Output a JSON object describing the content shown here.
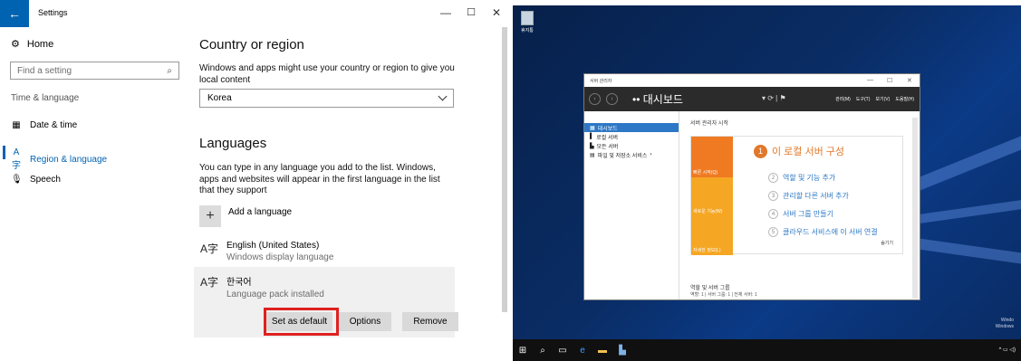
{
  "settings": {
    "window_title": "Settings",
    "back_icon": "back-arrow-icon",
    "controls": {
      "minimize": "—",
      "maximize": "☐",
      "close": "✕"
    },
    "nav": {
      "home": "Home",
      "search_placeholder": "Find a setting",
      "section": "Time & language",
      "items": [
        {
          "label": "Date & time",
          "icon": "calendar-clock-icon",
          "active": false
        },
        {
          "label": "Region & language",
          "icon": "region-language-icon",
          "active": true
        },
        {
          "label": "Speech",
          "icon": "microphone-icon",
          "active": false
        }
      ]
    },
    "country": {
      "heading": "Country or region",
      "description": "Windows and apps might use your country or region to give you local content",
      "selected": "Korea"
    },
    "languages": {
      "heading": "Languages",
      "description": "You can type in any language you add to the list. Windows, apps and websites will appear in the first language in the list that they support",
      "add_label": "Add a language",
      "list": [
        {
          "name": "English (United States)",
          "status": "Windows display language"
        },
        {
          "name": "한국어",
          "status": "Language pack installed"
        }
      ],
      "buttons": {
        "set_default": "Set as default",
        "options": "Options",
        "remove": "Remove"
      }
    }
  },
  "server": {
    "desktop_icon_label": "휴지통",
    "window_title": "서버 관리자",
    "breadcrumb": "•• 대시보드",
    "menu": [
      "관리(M)",
      "도구(T)",
      "보기(V)",
      "도움말(H)"
    ],
    "left_nav": [
      "대시보드",
      "로컬 서버",
      "모든 서버",
      "파일 및 저장소 서비스"
    ],
    "start_label": "서버 관리자 시작",
    "tiles": [
      "빠른 시작(Q)",
      "새로운 기능(W)",
      "자세한 정보(L)"
    ],
    "step1": {
      "num": "1",
      "label": "이 로컬 서버 구성"
    },
    "steps": [
      {
        "num": "2",
        "label": "역할 및 기능 추가"
      },
      {
        "num": "3",
        "label": "관리할 다른 서버 추가"
      },
      {
        "num": "4",
        "label": "서버 그룹 만들기"
      },
      {
        "num": "5",
        "label": "클라우드 서비스에 이 서버 연결"
      }
    ],
    "hide_label": "숨기기",
    "roles_title": "역할 및 서버 그룹",
    "roles_sub": "역할: 1  |  서버 그룹: 1  |  전체 서버: 1",
    "watermark": "Windo\nWindows"
  },
  "colors": {
    "accent": "#0063b1",
    "highlight": "#e02020",
    "quick_start": "#f07a22",
    "tile": "#f5a623"
  }
}
